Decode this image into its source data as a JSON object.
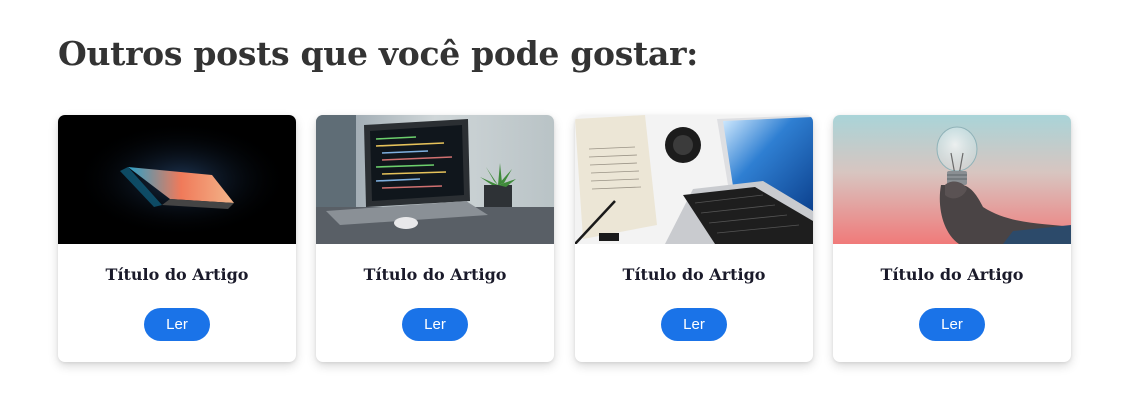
{
  "section": {
    "heading": "Outros posts que você pode gostar:"
  },
  "cards": [
    {
      "title": "Título do Artigo",
      "button_label": "Ler",
      "image": "laptop-dark-glow"
    },
    {
      "title": "Título do Artigo",
      "button_label": "Ler",
      "image": "laptop-code-plant"
    },
    {
      "title": "Título do Artigo",
      "button_label": "Ler",
      "image": "desk-laptop-camera-lens"
    },
    {
      "title": "Título do Artigo",
      "button_label": "Ler",
      "image": "hand-holding-lightbulb"
    }
  ],
  "colors": {
    "heading": "#333333",
    "button": "#1a73e8",
    "button_text": "#ffffff",
    "card_title": "#1a1a2a"
  }
}
